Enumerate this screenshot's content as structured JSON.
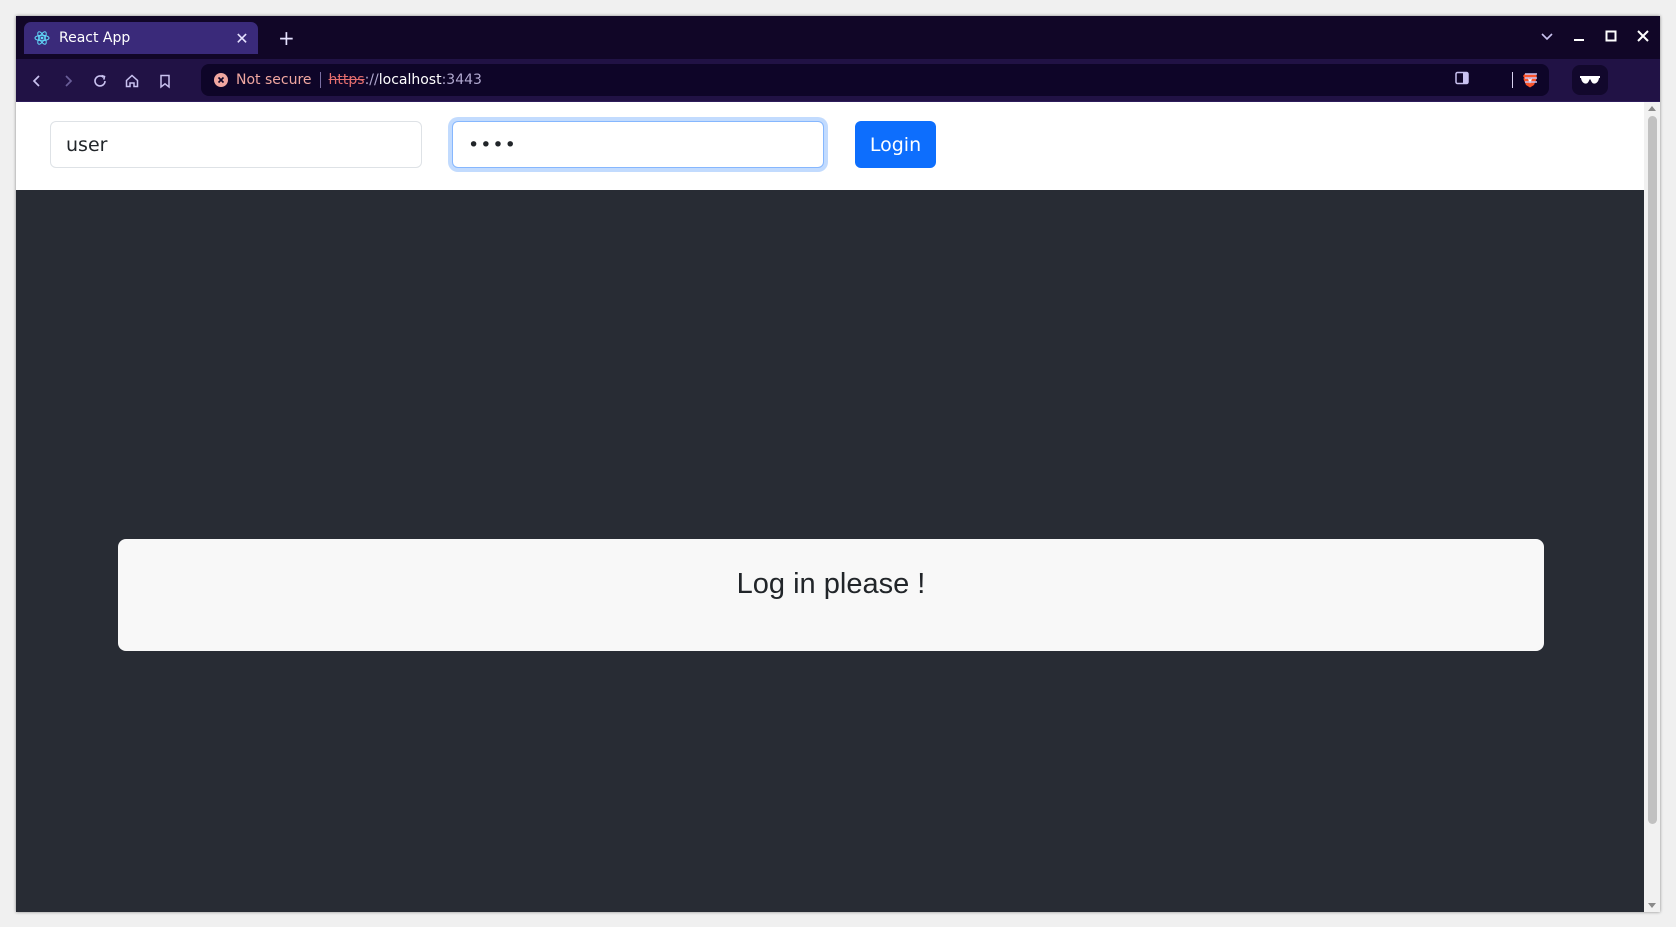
{
  "browser": {
    "tab": {
      "title": "React App",
      "close_glyph": "✕"
    },
    "new_tab_glyph": "+",
    "address": {
      "security_label": "Not secure",
      "url_scheme": "https",
      "url_separator": "://",
      "url_host": "localhost",
      "url_port": ":3443"
    },
    "colors": {
      "tabstrip": "#110627",
      "active_tab": "#3a2a7a",
      "toolbar": "#211245",
      "omnibox": "#0e0528"
    }
  },
  "login": {
    "username_value": "user",
    "password_value": "••••",
    "button_label": "Login"
  },
  "main": {
    "message": "Log in please !"
  },
  "colors": {
    "page_bg": "#282c34",
    "primary": "#0d6efd",
    "card_bg": "#f8f8f8"
  }
}
